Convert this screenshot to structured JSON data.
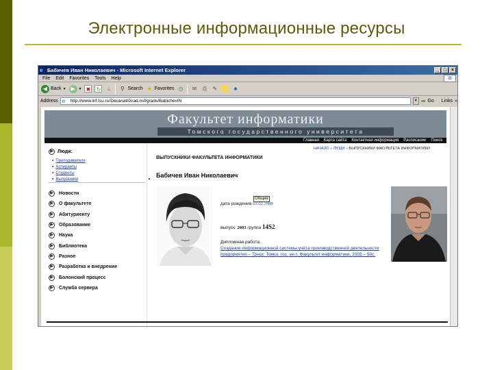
{
  "slide": {
    "title": "Электронные информационные ресурсы",
    "colors": {
      "bar_dark": "#5a5f00",
      "bar_mid": "#a9b52c",
      "bar_light": "#c6cc55",
      "title": "#5e5a06",
      "rule": "#b8ba2a"
    }
  },
  "browser": {
    "window_title": "Бабичев Иван Николаевич - Microsoft Internet Explorer",
    "menu": [
      "File",
      "Edit",
      "Favorites",
      "Tools",
      "Help"
    ],
    "toolbar": {
      "back": "Back",
      "search": "Search",
      "favorites": "Favorites"
    },
    "address_label": "Address",
    "address_value": "http://www.inf.tsu.ru/Decanat/Grad.nsf/grads/BabichevIN",
    "go_label": "Go",
    "links_label": "Links",
    "links_chevron": "»"
  },
  "site": {
    "name": "Факультет информатики",
    "subtitle": "Томского государственного университета",
    "nav": [
      "Главная",
      "Карта сайта",
      "Контактная информация",
      "Расписание",
      "Поиск"
    ],
    "people_heading": "Люди:",
    "people_links": [
      "Преподаватели",
      "Аспиранты",
      "Студенты",
      "Выпускники"
    ],
    "menu": [
      "Новости",
      "О факультете",
      "Абитуриенту",
      "Образование",
      "Наука",
      "Библиотека",
      "Разное",
      "Разработка и внедрение",
      "Болонский процесс",
      "Служба сервера"
    ],
    "breadcrumb": [
      "НАЧАЛО",
      "ЛЮДИ",
      "ВЫПУСКНИКИ ФАКУЛЬТЕТА ИНФОРМАТИКИ"
    ],
    "breadcrumb_sep": "»",
    "section_heading": "ВЫПУСКНИКИ ФАКУЛЬТЕТА ИНФОРМАТИКИ",
    "person_name": "Бабичев Иван Николаевич",
    "tooltip": "Общие",
    "dob_label": "дата рождения",
    "dob_value": "03.02.1988",
    "grad_label": "выпуск:",
    "grad_year": "2003",
    "group_label": "группа",
    "group_value": "14S2",
    "thesis_label": "Дипломная работа:",
    "thesis_text": "Создание информационной системы учёта производственной деятельности предприятия – Трнск: Томск. гос. ун-т. Факультет информатики, 2003.– 50с."
  }
}
